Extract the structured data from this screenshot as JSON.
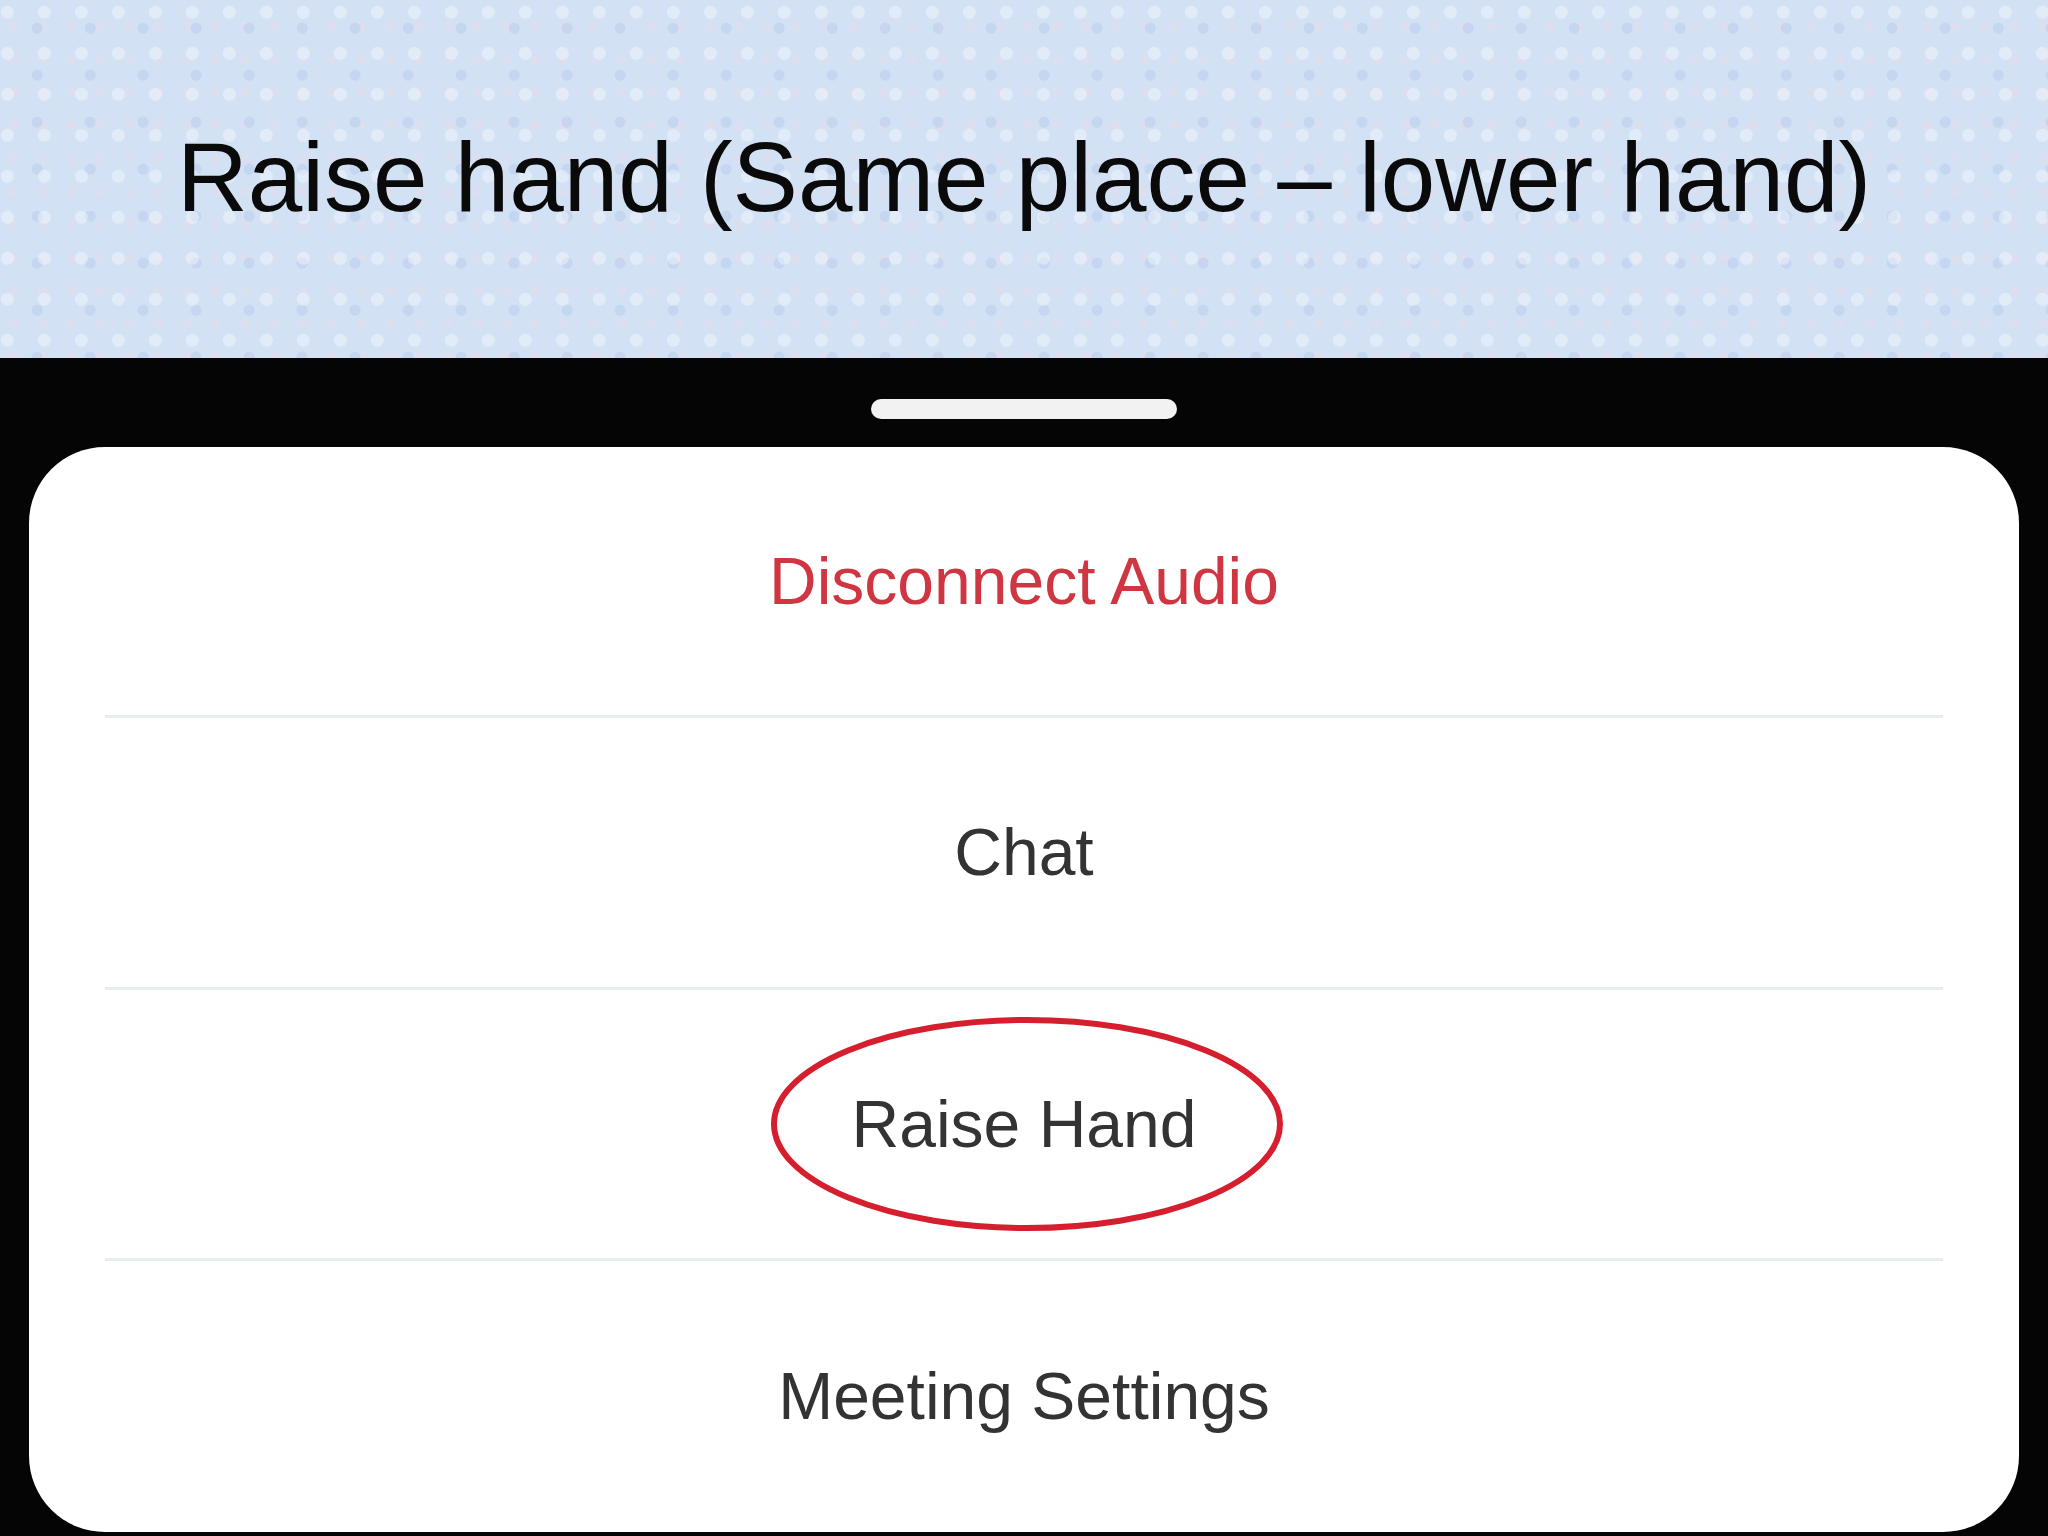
{
  "slide": {
    "title": "Raise hand (Same place – lower hand)"
  },
  "menu": {
    "items": [
      {
        "label": "Disconnect Audio",
        "kind": "destructive",
        "circled": false
      },
      {
        "label": "Chat",
        "kind": "normal",
        "circled": false
      },
      {
        "label": "Raise Hand",
        "kind": "normal",
        "circled": true
      },
      {
        "label": "Meeting Settings",
        "kind": "normal",
        "circled": false
      }
    ]
  }
}
